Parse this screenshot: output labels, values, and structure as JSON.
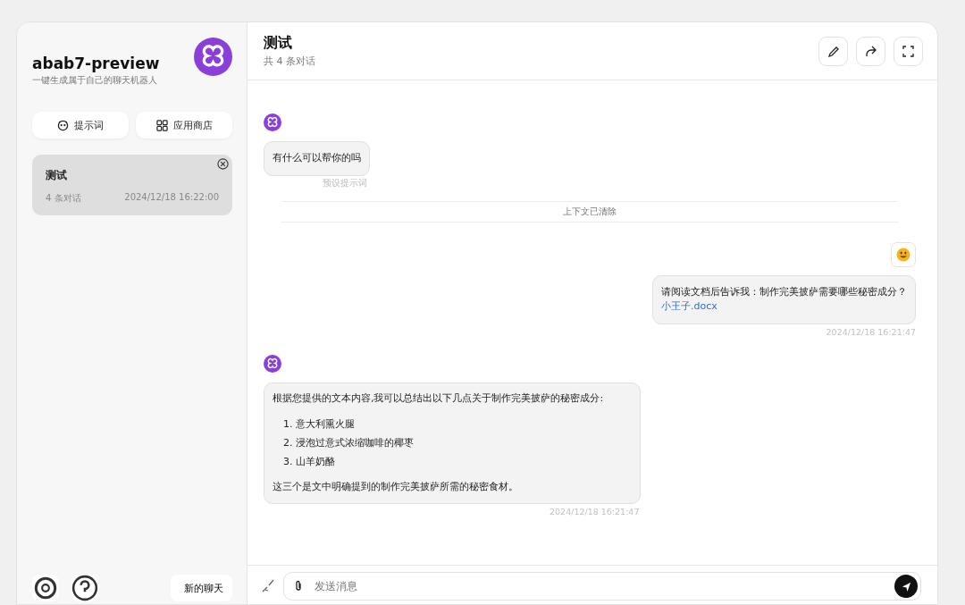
{
  "sidebar": {
    "title": "abab7-preview",
    "subtitle": "一键生成属于自己的聊天机器人",
    "buttons": [
      {
        "label": "提示词"
      },
      {
        "label": "应用商店"
      }
    ],
    "sessions": [
      {
        "title": "测试",
        "count": "4 条对话",
        "time": "2024/12/18 16:22:00",
        "selected": true
      }
    ],
    "new_chat": "新的聊天"
  },
  "header": {
    "title": "测试",
    "subtitle": "共 4 条对话"
  },
  "messages": [
    {
      "kind": "bot",
      "text": "有什么可以帮你的吗",
      "note": "预设提示词"
    },
    {
      "kind": "divider",
      "text": "上下文已清除"
    },
    {
      "kind": "user",
      "text": "请阅读文档后告诉我：制作完美披萨需要哪些秘密成分？",
      "attachment": "小王子.docx",
      "time": "2024/12/18 16:21:47"
    },
    {
      "kind": "answer",
      "intro": "根据您提供的文本内容,我可以总结出以下几点关于制作完美披萨的秘密成分:",
      "items": [
        "1. 意大利熏火腿",
        "2. 浸泡过意式浓缩咖啡的椰枣",
        "3. 山羊奶酪"
      ],
      "outro": "这三个是文中明确提到的制作完美披萨所需的秘密食材。",
      "time": "2024/12/18 16:21:47"
    }
  ],
  "input": {
    "placeholder": "发送消息"
  }
}
